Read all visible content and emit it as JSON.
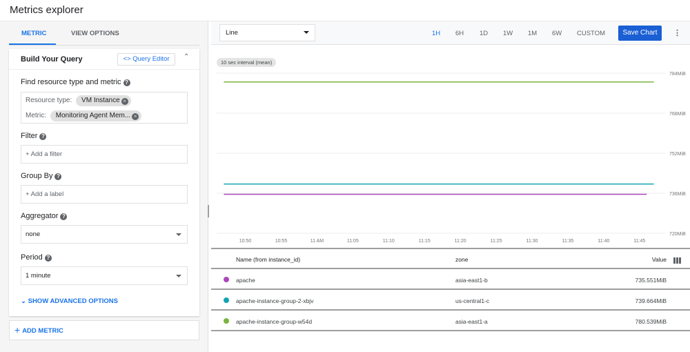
{
  "app": {
    "title": "Metrics explorer"
  },
  "left_tabs": [
    {
      "label": "METRIC",
      "active": true
    },
    {
      "label": "VIEW OPTIONS",
      "active": false
    }
  ],
  "query": {
    "title": "Build Your Query",
    "editor_button": "<> Query Editor",
    "find_label": "Find resource type and metric",
    "resource_type_label": "Resource type:",
    "resource_type_value": "VM Instance",
    "metric_label": "Metric:",
    "metric_value": "Monitoring Agent Mem...",
    "filter_label": "Filter",
    "filter_placeholder": "+ Add a filter",
    "groupby_label": "Group By",
    "groupby_placeholder": "+ Add a label",
    "aggregator_label": "Aggregator",
    "aggregator_value": "none",
    "period_label": "Period",
    "period_value": "1 minute",
    "advanced_label": "SHOW ADVANCED OPTIONS",
    "add_metric_label": "ADD METRIC"
  },
  "toolbar": {
    "chart_type": "Line",
    "ranges": [
      {
        "label": "1H",
        "active": true
      },
      {
        "label": "6H",
        "active": false
      },
      {
        "label": "1D",
        "active": false
      },
      {
        "label": "1W",
        "active": false
      },
      {
        "label": "1M",
        "active": false
      },
      {
        "label": "6W",
        "active": false
      },
      {
        "label": "CUSTOM",
        "active": false
      }
    ],
    "save_label": "Save Chart",
    "more_icon": "⋮"
  },
  "interval_badge": "10 sec interval (mean)",
  "chart_data": {
    "type": "line",
    "title": "",
    "xlabel": "",
    "ylabel": "",
    "x_ticks": [
      "10:50",
      "10:55",
      "11 AM",
      "11:05",
      "11:10",
      "11:15",
      "11:20",
      "11:25",
      "11:30",
      "11:35",
      "11:40",
      "11:45"
    ],
    "y_ticks": [
      "720MiB",
      "736MiB",
      "752MiB",
      "768MiB",
      "784MiB"
    ],
    "ylim": [
      720,
      784
    ],
    "grid": true,
    "series": [
      {
        "name": "apache-instance-group-w54d",
        "color": "#7cb342",
        "values": [
          780.5,
          780.5
        ],
        "x_range": [
          "10:47",
          "11:47"
        ]
      },
      {
        "name": "apache-instance-group-2-xbjv",
        "color": "#12a4b5",
        "values": [
          739.7,
          739.7
        ],
        "x_range": [
          "10:47",
          "11:47"
        ]
      },
      {
        "name": "apache",
        "color": "#ab47bc",
        "values": [
          735.6,
          735.6
        ],
        "x_range": [
          "10:47",
          "11:46"
        ]
      }
    ]
  },
  "table": {
    "headers": {
      "name": "Name (from instance_id)",
      "zone": "zone",
      "value": "Value"
    },
    "rows": [
      {
        "color": "#ab47bc",
        "name": "apache",
        "zone": "asia-east1-b",
        "value": "735.551MiB"
      },
      {
        "color": "#12a4b5",
        "name": "apache-instance-group-2-xbjv",
        "zone": "us-central1-c",
        "value": "739.664MiB"
      },
      {
        "color": "#7cb342",
        "name": "apache-instance-group-w54d",
        "zone": "asia-east1-a",
        "value": "780.539MiB"
      }
    ]
  }
}
